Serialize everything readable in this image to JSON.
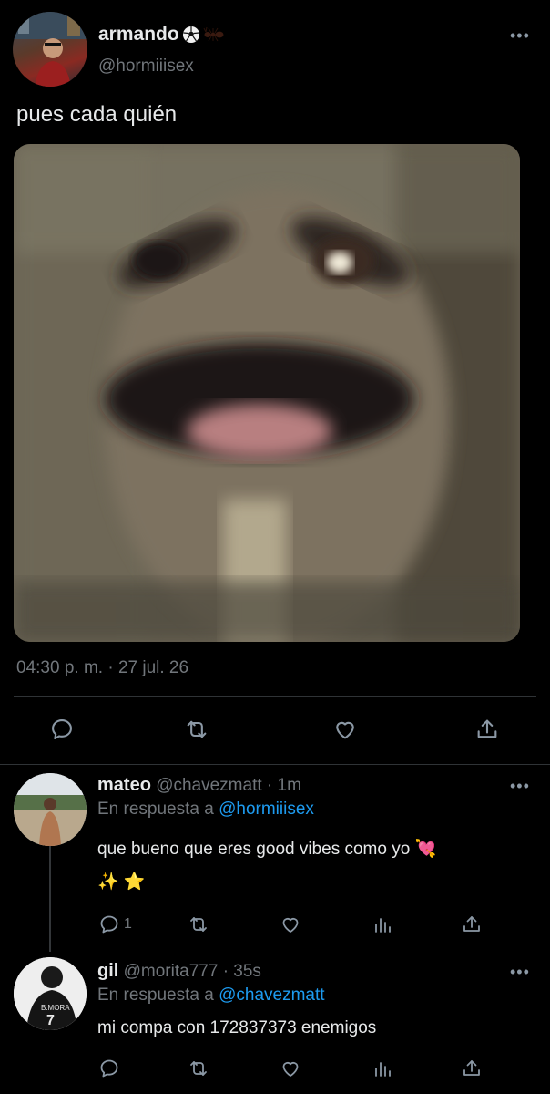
{
  "main_tweet": {
    "display_name": "armando",
    "handle": "@hormiiisex",
    "text": "pues cada quién",
    "timestamp": "04:30 p. m. · 27 jul. 26",
    "more_icon": "more-horizontal-icon",
    "actions": [
      "reply-icon",
      "retweet-icon",
      "like-icon",
      "share-icon"
    ]
  },
  "replies": [
    {
      "display_name": "mateo",
      "handle": "@chavezmatt",
      "time": "· 1m",
      "replying_prefix": "En respuesta a",
      "replying_to": "@hormiiisex",
      "text_line1": "que bueno que eres good vibes como yo 💘",
      "text_line2": "✨ ⭐",
      "reply_count": "1"
    },
    {
      "display_name": "gil",
      "handle": "@morita777",
      "time": "· 35s",
      "replying_prefix": "En respuesta a",
      "replying_to": "@chavezmatt",
      "text_line1": "mi compa con 172837373 enemigos"
    }
  ],
  "colors": {
    "background": "#000000",
    "text": "#e7e9ea",
    "muted": "#71767b",
    "link": "#1d9bf0",
    "divider": "#2f3336"
  }
}
